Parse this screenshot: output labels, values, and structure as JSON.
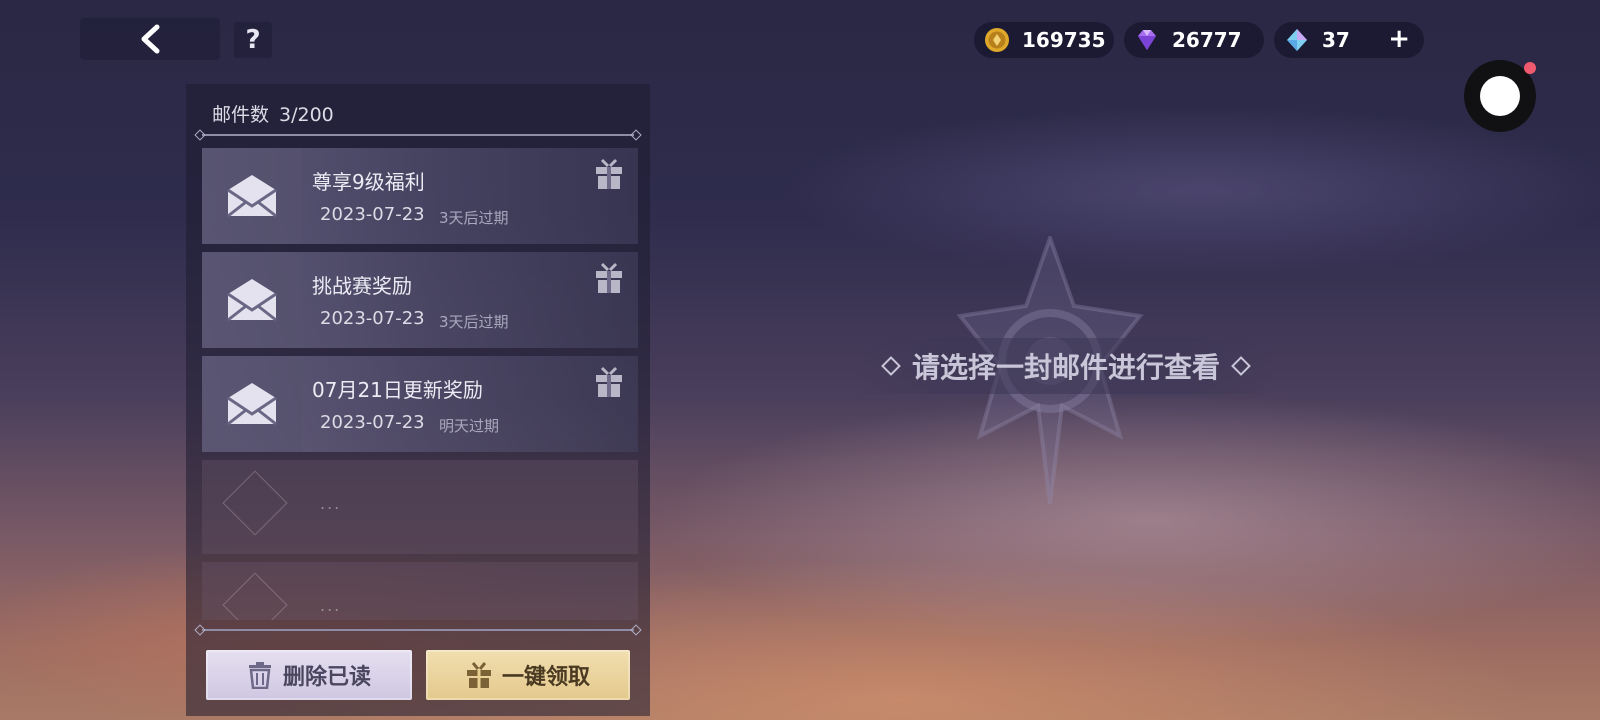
{
  "nav": {
    "back_icon": "chevron-left-icon",
    "help_label": "?"
  },
  "currencies": [
    {
      "icon": "gold-coin-icon",
      "value": "169735"
    },
    {
      "icon": "purple-gem-icon",
      "value": "26777"
    },
    {
      "icon": "blue-crystal-icon",
      "value": "37",
      "add_label": "+"
    }
  ],
  "mailbox": {
    "count_label": "邮件数",
    "count_value": "3/200",
    "items": [
      {
        "title": "尊享9级福利",
        "date": "2023-07-23",
        "expire": "3天后过期"
      },
      {
        "title": "挑战赛奖励",
        "date": "2023-07-23",
        "expire": "3天后过期"
      },
      {
        "title": "07月21日更新奖励",
        "date": "2023-07-23",
        "expire": "明天过期"
      }
    ],
    "empty_dots": "...",
    "delete_read_label": "删除已读",
    "claim_all_label": "一键领取"
  },
  "empty_state": {
    "hint": "请选择一封邮件进行查看"
  },
  "colors": {
    "claim_button": "#e9d39e",
    "delete_button": "#d9d2e8",
    "record_badge": "#ef5a6e"
  }
}
